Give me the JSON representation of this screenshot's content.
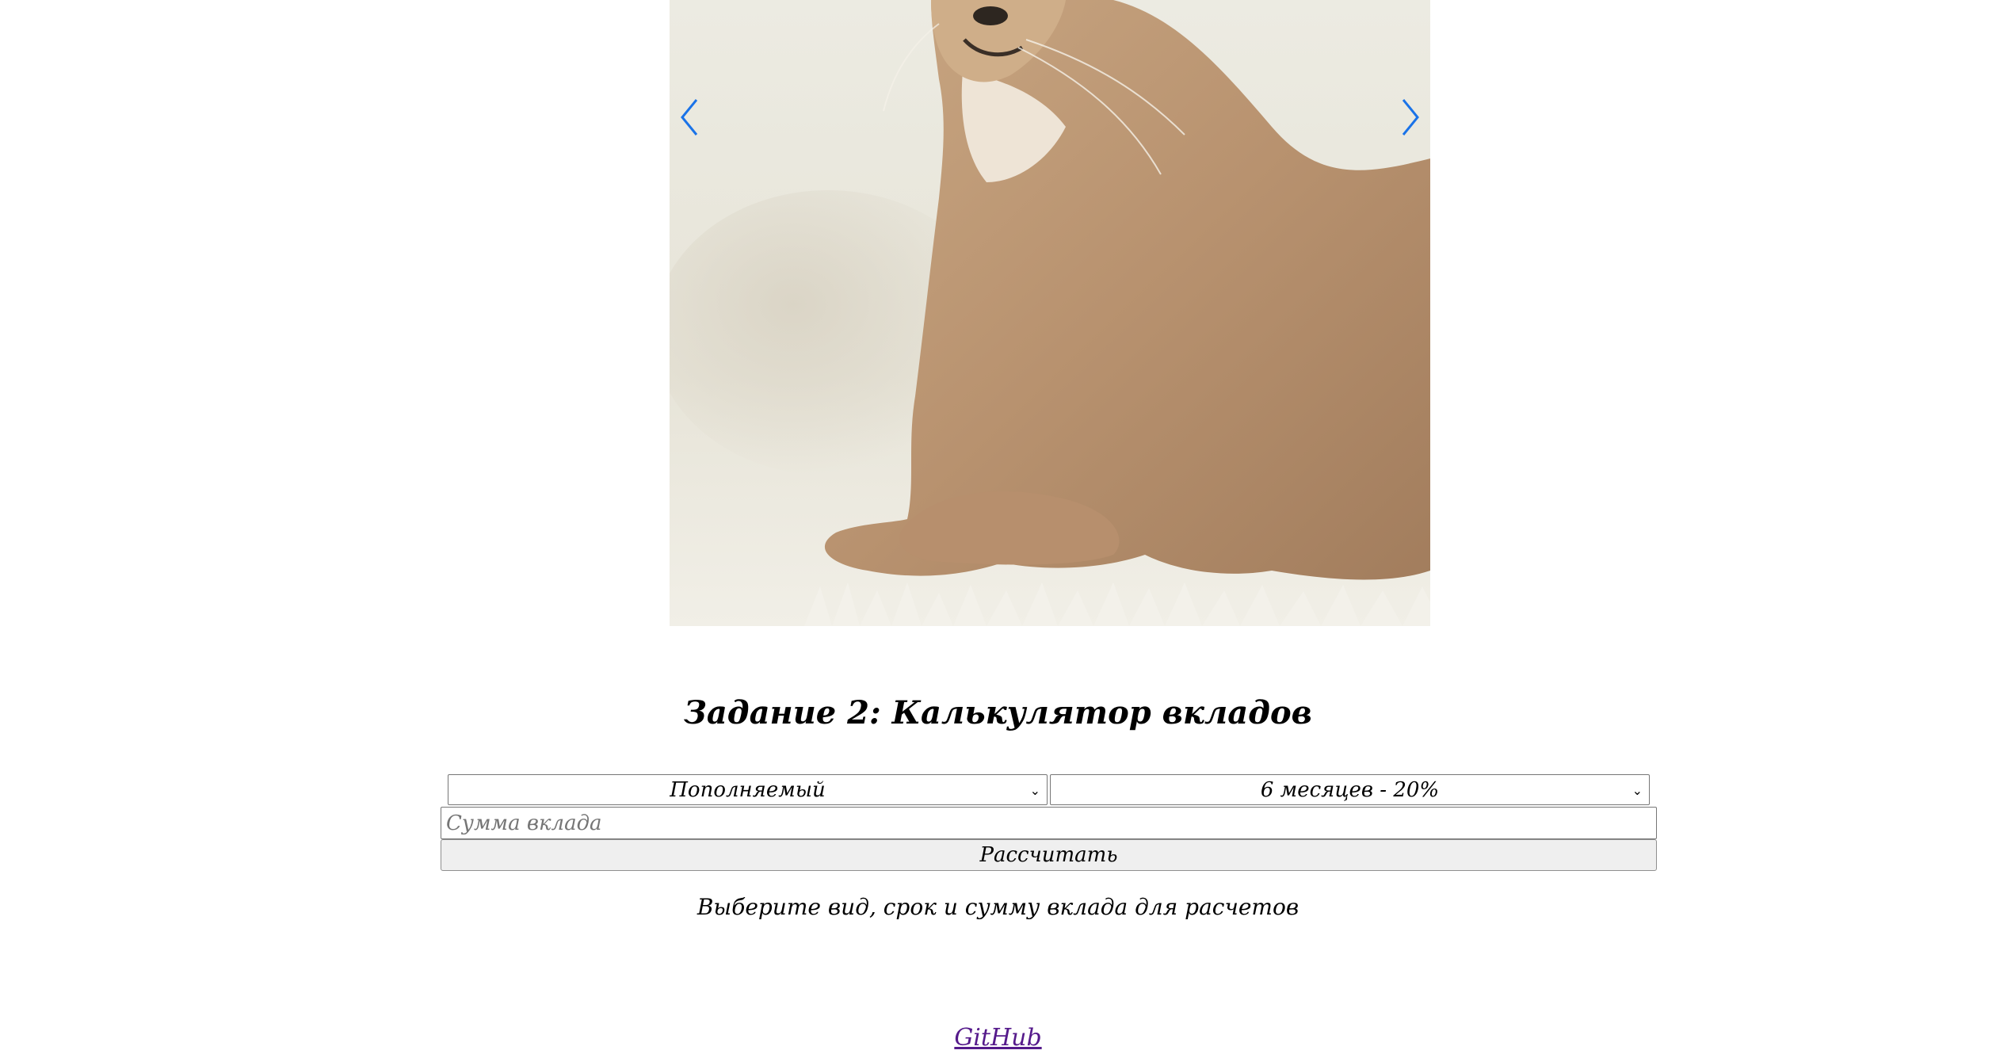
{
  "slider": {
    "image_alt": "Caracal cat on white fur rug",
    "prev_icon": "chevron-left-icon",
    "next_icon": "chevron-right-icon",
    "arrow_color": "#1a73e8"
  },
  "heading": {
    "title": "Задание 2: Калькулятор вкладов"
  },
  "calculator": {
    "deposit_type": "Пополняемый",
    "deposit_term": "6 месяцев - 20%",
    "amount_value": "",
    "amount_placeholder": "Сумма вклада",
    "calculate_label": "Рассчитать",
    "hint": "Выберите вид, срок и сумму вклада для расчетов"
  },
  "footer": {
    "link_label": "GitHub",
    "link_color": "#551a8b"
  }
}
